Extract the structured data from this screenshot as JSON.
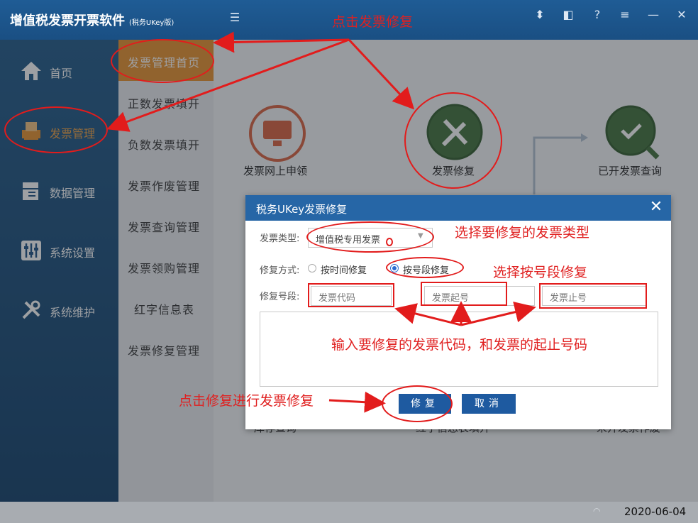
{
  "app": {
    "title": "增值税发票开票软件",
    "subtitle": "(税务UKey版)"
  },
  "titlebar_icons": [
    "collapse-icon",
    "pin-icon",
    "window-icon",
    "help-icon",
    "menu-icon",
    "minimize-icon",
    "close-icon"
  ],
  "titlebar_glyphs": {
    "collapse": "☰",
    "pin": "⬍",
    "window": "◧",
    "help": "?",
    "menu": "≡",
    "minimize": "—",
    "close": "✕"
  },
  "sidebar": {
    "items": [
      {
        "label": "首页",
        "icon": "home-icon"
      },
      {
        "label": "发票管理",
        "icon": "printer-icon",
        "active": true
      },
      {
        "label": "数据管理",
        "icon": "database-icon"
      },
      {
        "label": "系统设置",
        "icon": "settings-icon"
      },
      {
        "label": "系统维护",
        "icon": "tools-icon"
      }
    ]
  },
  "submenu": {
    "items": [
      "发票管理首页",
      "正数发票填开",
      "负数发票填开",
      "发票作废管理",
      "发票查询管理",
      "发票领购管理",
      "红字信息表",
      "发票修复管理"
    ]
  },
  "main": {
    "features": [
      {
        "label": "发票网上申领",
        "icon": "apply-icon"
      },
      {
        "label": "发票修复",
        "icon": "repair-icon"
      },
      {
        "label": "已开发票查询",
        "icon": "query-icon"
      }
    ],
    "bottom_features": [
      "库存查询",
      "红字信息表填开",
      "未开发票作废"
    ]
  },
  "dialog": {
    "title": "税务UKey发票修复",
    "close_glyph": "✕",
    "type_label": "发票类型:",
    "type_value": "增值税专用发票",
    "mode_label": "修复方式:",
    "mode_options": [
      "按时间修复",
      "按号段修复"
    ],
    "mode_selected": "按号段修复",
    "range_label": "修复号段:",
    "code_placeholder": "发票代码",
    "start_placeholder": "发票起号",
    "end_placeholder": "发票止号",
    "ok_label": "修复",
    "cancel_label": "取消"
  },
  "annotations": {
    "click_repair": "点击发票修复",
    "choose_type": "选择要修复的发票类型",
    "choose_range": "选择按号段修复",
    "input_codes": "输入要修复的发票代码，和发票的起止号码",
    "click_fix": "点击修复进行发票修复"
  },
  "status": {
    "date": "2020-06-04"
  },
  "colors": {
    "titlebar": "#1f5c95",
    "accent_orange": "#e8902a",
    "dialog_header": "#2666a6",
    "annotation_red": "#e21c1c",
    "button_blue": "#1e5aa0"
  }
}
